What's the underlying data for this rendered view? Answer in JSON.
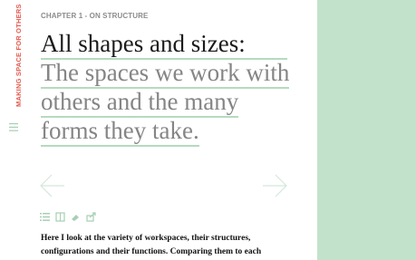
{
  "sidebar": {
    "vertical_title": "MAKING SPACE FOR OTHERS",
    "menu_icon": "hamburger-menu-icon"
  },
  "header": {
    "chapter": "CHAPTER 1 - ON STRUCTURE"
  },
  "title": {
    "main": "All shapes and sizes:",
    "sub_lines": [
      "The spaces we work with",
      "others and the many",
      "forms they take."
    ]
  },
  "navigation": {
    "prev_icon": "arrow-left-icon",
    "next_icon": "arrow-right-icon"
  },
  "toolbar": {
    "icons": [
      "list-icon",
      "book-icon",
      "highlight-icon",
      "share-icon"
    ]
  },
  "body": {
    "lines": [
      "Here I look at the variety of workspaces, their structures,",
      "configurations and their functions. Comparing them to each"
    ]
  },
  "colors": {
    "accent_green": "#c3e2cc",
    "underline_green": "#b6dabf",
    "side_title_red": "#e35b4f"
  }
}
